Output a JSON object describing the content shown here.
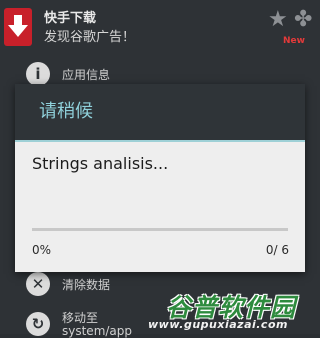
{
  "app": {
    "title": "快手下载",
    "subtitle": "发现谷歌广告！",
    "badge": "New",
    "icons": [
      "app-icon",
      "star-icon",
      "clover-icon"
    ]
  },
  "background_list": {
    "items": [
      {
        "label": "应用信息",
        "icon": "info-icon",
        "glyph": "i"
      },
      {
        "label": "清除数据",
        "icon": "close-icon",
        "glyph": "✕"
      },
      {
        "label": "移动至",
        "icon": "move-icon",
        "glyph": "↻"
      }
    ],
    "move_subtext": "system/app"
  },
  "dialog": {
    "title": "请稍候",
    "message": "Strings analisis...",
    "progress_percent_text": "0%",
    "progress_count_text": "0/ 6",
    "progress_fraction": 0,
    "accent_color": "#2ea3c6",
    "title_color": "#8fd0da"
  },
  "watermark": {
    "cn": "谷普软件园",
    "url": "www.gupuxiazai.com"
  }
}
